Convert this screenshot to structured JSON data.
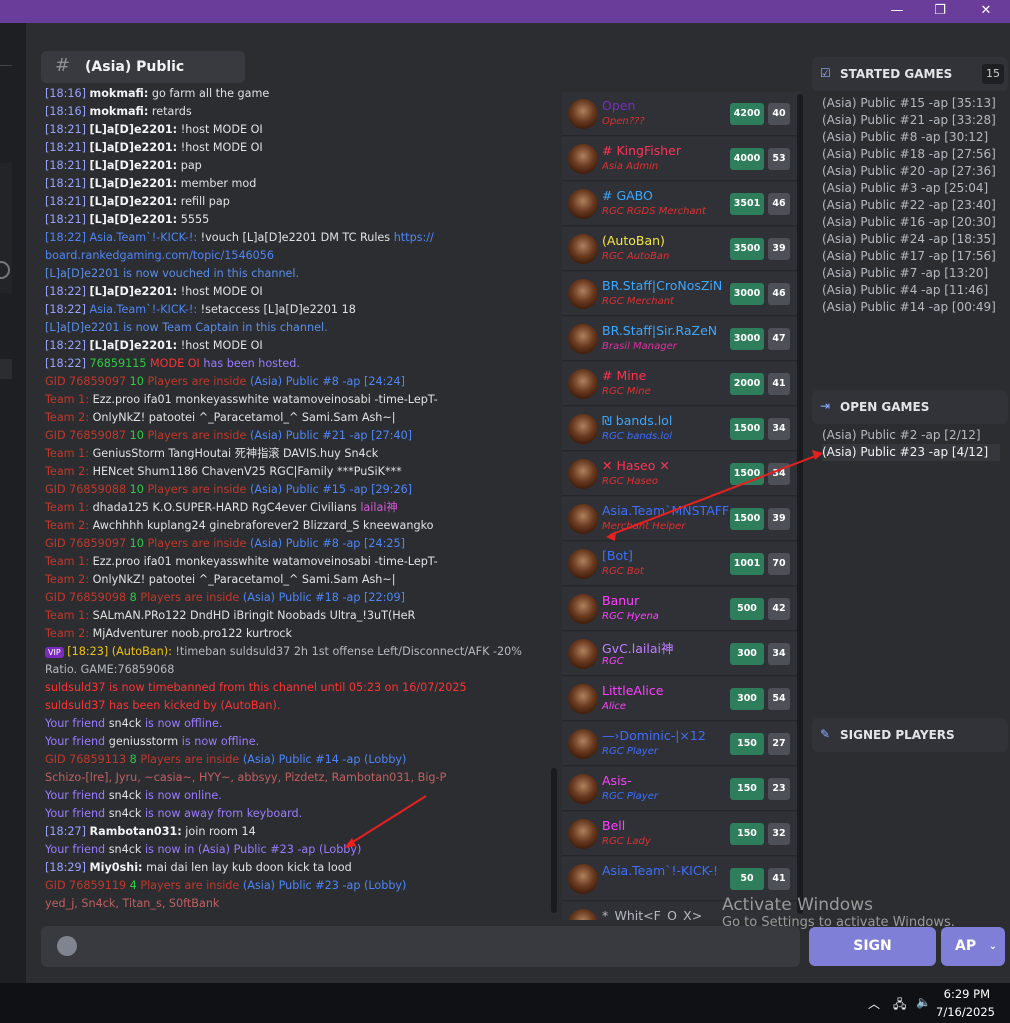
{
  "window": {
    "minimize": "—",
    "restore": "❐",
    "close": "✕"
  },
  "channel": {
    "icon": "#",
    "name": "(Asia) Public"
  },
  "chat": [
    {
      "parts": [
        [
          "t",
          "[18:16] "
        ],
        [
          "u",
          "mokmafi:"
        ],
        [
          "g",
          " go farm all the game"
        ]
      ]
    },
    {
      "parts": [
        [
          "t",
          "[18:16] "
        ],
        [
          "u",
          "mokmafi:"
        ],
        [
          "g",
          " retards"
        ]
      ]
    },
    {
      "parts": [
        [
          "t",
          "[18:21] "
        ],
        [
          "u",
          "[L]a[D]e2201:"
        ],
        [
          "g",
          " !host MODE OI"
        ]
      ]
    },
    {
      "parts": [
        [
          "t",
          "[18:21] "
        ],
        [
          "u",
          "[L]a[D]e2201:"
        ],
        [
          "g",
          " !host MODE OI"
        ]
      ]
    },
    {
      "parts": [
        [
          "t",
          "[18:21] "
        ],
        [
          "u",
          "[L]a[D]e2201:"
        ],
        [
          "g",
          " pap"
        ]
      ]
    },
    {
      "parts": [
        [
          "t",
          "[18:21] "
        ],
        [
          "u",
          "[L]a[D]e2201:"
        ],
        [
          "g",
          " member mod"
        ]
      ]
    },
    {
      "parts": [
        [
          "t",
          "[18:21] "
        ],
        [
          "u",
          "[L]a[D]e2201:"
        ],
        [
          "g",
          " refill pap"
        ]
      ]
    },
    {
      "parts": [
        [
          "t",
          "[18:21] "
        ],
        [
          "u",
          "[L]a[D]e2201:"
        ],
        [
          "g",
          " 5555"
        ]
      ]
    },
    {
      "parts": [
        [
          "b",
          "[18:22] "
        ],
        [
          "b",
          "Asia.Team`!-KICK-!:"
        ],
        [
          "g",
          " !vouch [L]a[D]e2201 DM TC Rules "
        ],
        [
          "b",
          "https://"
        ]
      ]
    },
    {
      "parts": [
        [
          "b",
          "board.rankedgaming.com/topic/1546056"
        ]
      ]
    },
    {
      "parts": [
        [
          "bl",
          "[L]a[D]e2201 is now vouched in this channel."
        ]
      ]
    },
    {
      "parts": [
        [
          "t",
          "[18:22] "
        ],
        [
          "u",
          "[L]a[D]e2201:"
        ],
        [
          "g",
          " !host MODE OI"
        ]
      ]
    },
    {
      "parts": [
        [
          "t",
          "[18:22] "
        ],
        [
          "b",
          "Asia.Team`!-KICK-!:"
        ],
        [
          "g",
          " !setaccess [L]a[D]e2201 18"
        ]
      ]
    },
    {
      "parts": [
        [
          "bl",
          "[L]a[D]e2201 is now Team Captain in this channel."
        ]
      ]
    },
    {
      "parts": [
        [
          "t",
          "[18:22] "
        ],
        [
          "u",
          "[L]a[D]e2201:"
        ],
        [
          "g",
          " !host MODE OI"
        ]
      ]
    },
    {
      "parts": [
        [
          "t",
          "[18:22] "
        ],
        [
          "gr",
          "76859115 "
        ],
        [
          "r",
          "MODE OI"
        ],
        [
          "pu",
          " has been hosted."
        ]
      ]
    },
    {
      "parts": [
        [
          "rd",
          "GID 76859097 "
        ],
        [
          "gr",
          "10 "
        ],
        [
          "rd",
          "Players are inside "
        ],
        [
          "b",
          "(Asia) Public #8 -ap [24:24]"
        ]
      ]
    },
    {
      "parts": [
        [
          "rd",
          "Team 1:"
        ],
        [
          "g",
          "   Ezz.proo   ifa01   monkeyasswhite   watamoveinosabi   -time-LepT-"
        ]
      ]
    },
    {
      "parts": [
        [
          "rd",
          "Team 2:"
        ],
        [
          "g",
          "   OnlyNkZ!   patootei   ^_Paracetamol_^   Sami.Sam   Ash~|"
        ]
      ]
    },
    {
      "parts": [
        [
          "rd",
          "GID 76859087 "
        ],
        [
          "gr",
          "10 "
        ],
        [
          "rd",
          "Players are inside "
        ],
        [
          "b",
          "(Asia) Public #21 -ap [27:40]"
        ]
      ]
    },
    {
      "parts": [
        [
          "rd",
          "Team 1:"
        ],
        [
          "g",
          "   GeniusStorm   TangHoutai   死神指滚   DAVIS.huy   Sn4ck"
        ]
      ]
    },
    {
      "parts": [
        [
          "rd",
          "Team 2:"
        ],
        [
          "g",
          "   HENcet   Shum1186   ChavenV25   RGC|Family   ***PuSiK***"
        ]
      ]
    },
    {
      "parts": [
        [
          "rd",
          "GID 76859088 "
        ],
        [
          "gr",
          "10 "
        ],
        [
          "rd",
          "Players are inside "
        ],
        [
          "b",
          "(Asia) Public #15 -ap [29:26]"
        ]
      ]
    },
    {
      "parts": [
        [
          "rd",
          "Team 1:"
        ],
        [
          "g",
          "   dhada125   K.O.SUPER-HARD   RgC4ever   Civilians   "
        ],
        [
          "pk",
          "lailai神"
        ]
      ]
    },
    {
      "parts": [
        [
          "rd",
          "Team 2:"
        ],
        [
          "g",
          "   Awchhhh   kuplang24   ginebraforever2   Blizzard_S   kneewangko"
        ]
      ]
    },
    {
      "parts": [
        [
          "rd",
          "GID 76859097 "
        ],
        [
          "gr",
          "10 "
        ],
        [
          "rd",
          "Players are inside "
        ],
        [
          "b",
          "(Asia) Public #8 -ap [24:25]"
        ]
      ]
    },
    {
      "parts": [
        [
          "rd",
          "Team 1:"
        ],
        [
          "g",
          "   Ezz.proo   ifa01   monkeyasswhite   watamoveinosabi   -time-LepT-"
        ]
      ]
    },
    {
      "parts": [
        [
          "rd",
          "Team 2:"
        ],
        [
          "g",
          "   OnlyNkZ!   patootei   ^_Paracetamol_^   Sami.Sam   Ash~|"
        ]
      ]
    },
    {
      "parts": [
        [
          "rd",
          "GID 76859098 "
        ],
        [
          "gr",
          "8 "
        ],
        [
          "rd",
          "Players are inside "
        ],
        [
          "b",
          "(Asia) Public #18 -ap [22:09]"
        ]
      ]
    },
    {
      "parts": [
        [
          "rd",
          "Team 1:"
        ],
        [
          "g",
          "   SALmAN.PRo122   DndHD   iBringit   Noobads   Ultra_!3uT(HeR"
        ]
      ]
    },
    {
      "parts": [
        [
          "rd",
          "Team 2:"
        ],
        [
          "g",
          "   MjAdventurer   noob.pro122   kurtrock"
        ]
      ]
    },
    {
      "parts": [
        [
          "vip",
          "VIP"
        ],
        [
          "yl",
          " [18:23] (AutoBan):"
        ],
        [
          "lt",
          " !timeban suldsuld37 2h 1st offense Left/Disconnect/AFK -20%"
        ]
      ]
    },
    {
      "parts": [
        [
          "lt",
          "Ratio. GAME:76859068"
        ]
      ]
    },
    {
      "parts": [
        [
          "r",
          "suldsuld37 is now timebanned from this channel until 05:23 on 16/07/2025"
        ]
      ]
    },
    {
      "parts": [
        [
          "r",
          "suldsuld37 has been kicked by (AutoBan)."
        ]
      ]
    },
    {
      "parts": [
        [
          "pu",
          "Your friend "
        ],
        [
          "g",
          "sn4ck"
        ],
        [
          "pu",
          " is now offline."
        ]
      ]
    },
    {
      "parts": [
        [
          "pu",
          "Your friend "
        ],
        [
          "g",
          "geniusstorm"
        ],
        [
          "pu",
          " is now offline."
        ]
      ]
    },
    {
      "parts": [
        [
          "rd",
          "GID 76859113 "
        ],
        [
          "gr",
          "8 "
        ],
        [
          "rd",
          "Players are inside "
        ],
        [
          "b",
          "(Asia) Public #14 -ap (Lobby)"
        ]
      ]
    },
    {
      "parts": [
        [
          "dim",
          "Schizo-[lre], Jyru, ~casia~, HYY~, abbsyy, Pizdetz, Rambotan031, Big-P"
        ]
      ]
    },
    {
      "parts": [
        [
          "pu",
          "Your friend "
        ],
        [
          "g",
          "sn4ck"
        ],
        [
          "pu",
          " is now online."
        ]
      ]
    },
    {
      "parts": [
        [
          "pu",
          "Your friend "
        ],
        [
          "g",
          "sn4ck"
        ],
        [
          "pu",
          " is now away from keyboard."
        ]
      ]
    },
    {
      "parts": [
        [
          "t",
          "[18:27] "
        ],
        [
          "u",
          "Rambotan031:"
        ],
        [
          "g",
          " join room 14"
        ]
      ]
    },
    {
      "parts": [
        [
          "pu",
          "Your friend "
        ],
        [
          "g",
          "sn4ck"
        ],
        [
          "pu",
          " is now in (Asia) Public #23 -ap (Lobby)"
        ]
      ]
    },
    {
      "parts": [
        [
          "t",
          "[18:29] "
        ],
        [
          "u",
          "Miy0shi:"
        ],
        [
          "g",
          " mai dai len lay kub doon kick ta lood"
        ]
      ]
    },
    {
      "parts": [
        [
          "rd",
          "GID 76859119 "
        ],
        [
          "gr",
          "4 "
        ],
        [
          "rd",
          "Players are inside "
        ],
        [
          "b",
          "(Asia) Public #23 -ap (Lobby)"
        ]
      ]
    },
    {
      "parts": [
        [
          "dim",
          "yed_j, Sn4ck, Titan_s, S0ftBank"
        ]
      ]
    }
  ],
  "players": [
    {
      "name": "Open",
      "role": "Open???",
      "score": "4200",
      "games": "40",
      "nc": "#7b2cbf",
      "rc": "#e03030"
    },
    {
      "name": "# KingFisher",
      "role": "Asia Admin",
      "score": "4000",
      "games": "53",
      "nc": "#ff3355",
      "rc": "#e03030"
    },
    {
      "name": "# GABO",
      "role": "RGC RGDS Merchant",
      "score": "3501",
      "games": "46",
      "nc": "#3da8ff",
      "rc": "#e03030"
    },
    {
      "name": "(AutoBan)",
      "role": "RGC AutoBan",
      "score": "3500",
      "games": "39",
      "nc": "#f5e642",
      "rc": "#e03030"
    },
    {
      "name": "BR.Staff|CroNosZiN",
      "role": "RGC Merchant",
      "score": "3000",
      "games": "46",
      "nc": "#3da8ff",
      "rc": "#e03030"
    },
    {
      "name": "BR.Staff|Sir.RaZeN",
      "role": "Brasil Manager",
      "score": "3000",
      "games": "47",
      "nc": "#3da8ff",
      "rc": "#e030a0"
    },
    {
      "name": "# Mine",
      "role": "RGC Mine",
      "score": "2000",
      "games": "41",
      "nc": "#ff3355",
      "rc": "#e03030"
    },
    {
      "name": "₪ bands.lol",
      "role": "RGC bands.lol",
      "score": "1500",
      "games": "34",
      "nc": "#3da8ff",
      "rc": "#3d6fff"
    },
    {
      "name": "✕ Haseo ✕",
      "role": "RGC Haseo",
      "score": "1500",
      "games": "34",
      "nc": "#ff3355",
      "rc": "#e03030"
    },
    {
      "name": "Asia.Team`MNSTAFF",
      "role": "Merchant Helper",
      "score": "1500",
      "games": "39",
      "nc": "#3d6fff",
      "rc": "#e03030"
    },
    {
      "name": "[Bot]",
      "role": "RGC Bot",
      "score": "1001",
      "games": "70",
      "nc": "#3d6fff",
      "rc": "#e03030"
    },
    {
      "name": "Banur",
      "role": "RGC Hyena",
      "score": "500",
      "games": "42",
      "nc": "#ff40ff",
      "rc": "#ff40ff"
    },
    {
      "name": "GvC.lailai神",
      "role": "RGC",
      "score": "300",
      "games": "34",
      "nc": "#c080ff",
      "rc": "#ff40ff"
    },
    {
      "name": "LittleAlice",
      "role": "Alice",
      "score": "300",
      "games": "54",
      "nc": "#ff40ff",
      "rc": "#ff40ff"
    },
    {
      "name": "—›Dominic-|×12",
      "role": "RGC Player",
      "score": "150",
      "games": "27",
      "nc": "#3d6fff",
      "rc": "#3d6fff"
    },
    {
      "name": "Asis-",
      "role": "RGC Player",
      "score": "150",
      "games": "23",
      "nc": "#ff40ff",
      "rc": "#3d6fff"
    },
    {
      "name": "Bell",
      "role": "RGC Lady",
      "score": "150",
      "games": "32",
      "nc": "#ff40ff",
      "rc": "#e03030"
    },
    {
      "name": "Asia.Team`!-KICK-!",
      "role": "",
      "score": "50",
      "games": "41",
      "nc": "#3d6fff",
      "rc": "#e03030"
    },
    {
      "name": "*_Whit<F_O_X>_",
      "role": "",
      "score": "",
      "games": "",
      "nc": "#b5bac1",
      "rc": "#e03030"
    }
  ],
  "started": {
    "title": "STARTED GAMES",
    "count": "15",
    "items": [
      "(Asia) Public #15 -ap [35:13]",
      "(Asia) Public #21 -ap [33:28]",
      "(Asia) Public #8 -ap [30:12]",
      "(Asia) Public #18 -ap [27:56]",
      "(Asia) Public #20 -ap [27:36]",
      "(Asia) Public #3 -ap [25:04]",
      "(Asia) Public #22 -ap [23:40]",
      "(Asia) Public #16 -ap [20:30]",
      "(Asia) Public #24 -ap [18:35]",
      "(Asia) Public #17 -ap [17:56]",
      "(Asia) Public #7 -ap [13:20]",
      "(Asia) Public #4 -ap [11:46]",
      "(Asia) Public #14 -ap [00:49]"
    ]
  },
  "open": {
    "title": "OPEN GAMES",
    "items": [
      "(Asia) Public #2 -ap [2/12]",
      "(Asia) Public #23 -ap [4/12]"
    ]
  },
  "signed": {
    "title": "SIGNED PLAYERS"
  },
  "buttons": {
    "sign": "SIGN",
    "ap": "AP"
  },
  "watermark": {
    "line1": "Activate Windows",
    "line2": "Go to Settings to activate Windows."
  },
  "taskbar": {
    "time": "6:29 PM",
    "date": "7/16/2025"
  },
  "colors": {
    "titlebar": "#6a3d9a",
    "accent": "#7f7fd8",
    "score": "#2e7d5b"
  }
}
